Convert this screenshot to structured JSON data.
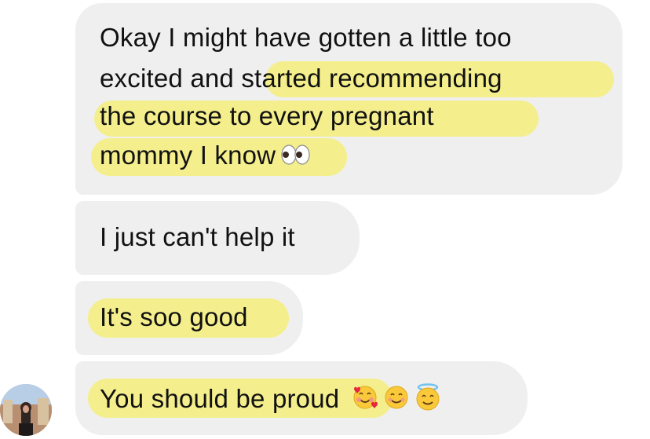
{
  "messages": [
    {
      "id": "msg1",
      "lines": [
        "Okay I might have gotten a little too",
        "excited and started recommending",
        "the course to every pregnant",
        "mommy I know"
      ],
      "emoji": [
        "eyes-emoji"
      ]
    },
    {
      "id": "msg2",
      "lines": [
        "I just can't help it"
      ]
    },
    {
      "id": "msg3",
      "lines": [
        "It's soo good"
      ]
    },
    {
      "id": "msg4",
      "lines": [
        "You should be proud"
      ],
      "emoji": [
        "smiling-face-with-hearts-emoji",
        "smiling-face-emoji",
        "smiling-face-with-halo-emoji"
      ]
    }
  ],
  "highlight_color": "#f3ee86",
  "bubble_color": "#efefef",
  "sender_avatar": "profile-photo"
}
